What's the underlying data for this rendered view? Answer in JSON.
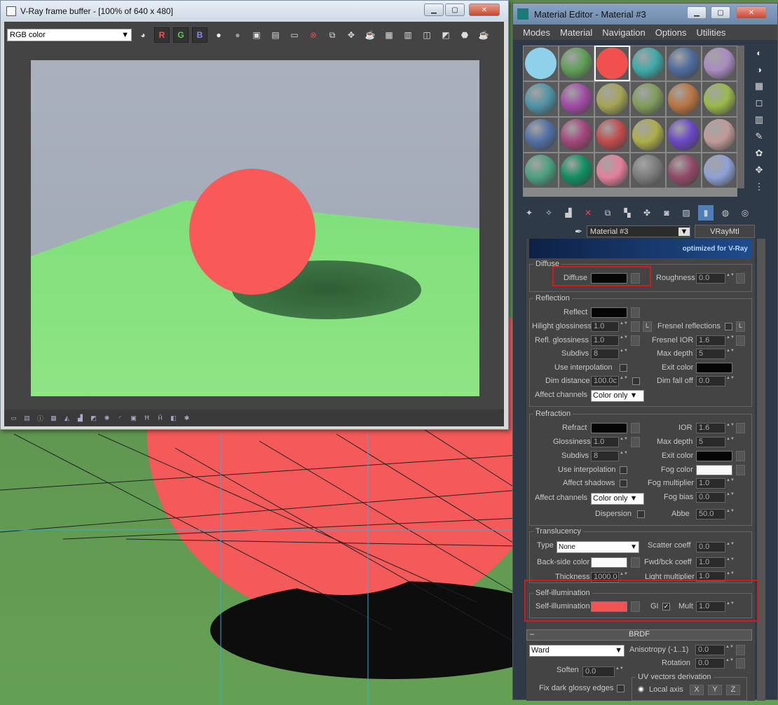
{
  "vfb": {
    "title": "V-Ray frame buffer - [100% of 640 x 480]",
    "channel": "RGB color",
    "ch_r": "R",
    "ch_g": "G",
    "ch_b": "B"
  },
  "me": {
    "title": "Material Editor - Material #3",
    "menus": [
      "Modes",
      "Material",
      "Navigation",
      "Options",
      "Utilities"
    ],
    "material_name": "Material #3",
    "material_type": "VRayMtl",
    "banner": "optimized for V-Ray"
  },
  "slots": [
    "#8fd0ea",
    "#5f9e57",
    "#f24f4f",
    "#3daaa8",
    "#4d6a9c",
    "#a98bc1",
    "#4f93a6",
    "#a04aa5",
    "#a6a454",
    "#7f9c5c",
    "#b9743f",
    "#9ab84a",
    "#4f6ea4",
    "#a3457b",
    "#c04a4a",
    "#adad49",
    "#6a46c5",
    "#c09a97",
    "#4aa07f",
    "#0e8f61",
    "#e47f9a",
    "#7b7b7b",
    "#914a66",
    "#8ea1d6"
  ],
  "diffuse": {
    "title": "Diffuse",
    "diffuse": "Diffuse",
    "roughness": "Roughness",
    "roughness_val": "0.0"
  },
  "reflection": {
    "title": "Reflection",
    "reflect": "Reflect",
    "hilight": "Hilight glossiness",
    "hilight_val": "1.0",
    "refl": "Refl. glossiness",
    "refl_val": "1.0",
    "subdivs": "Subdivs",
    "subdivs_val": "8",
    "interp": "Use interpolation",
    "dim": "Dim distance",
    "dim_val": "100.0c",
    "affect": "Affect channels",
    "affect_val": "Color only",
    "fresnel": "Fresnel reflections",
    "fresnel_ior": "Fresnel IOR",
    "fresnel_ior_val": "1.6",
    "maxd": "Max depth",
    "maxd_val": "5",
    "exit": "Exit color",
    "dimfall": "Dim fall off",
    "dimfall_val": "0.0",
    "L": "L"
  },
  "refraction": {
    "title": "Refraction",
    "refract": "Refract",
    "gloss": "Glossiness",
    "gloss_val": "1.0",
    "subdivs": "Subdivs",
    "subdivs_val": "8",
    "interp": "Use interpolation",
    "shadows": "Affect shadows",
    "affect": "Affect channels",
    "affect_val": "Color only",
    "disp": "Dispersion",
    "ior": "IOR",
    "ior_val": "1.6",
    "maxd": "Max depth",
    "maxd_val": "5",
    "exit": "Exit color",
    "fog": "Fog color",
    "fogmult": "Fog multiplier",
    "fogmult_val": "1.0",
    "fogbias": "Fog bias",
    "fogbias_val": "0.0",
    "abbe": "Abbe",
    "abbe_val": "50.0"
  },
  "transl": {
    "title": "Translucency",
    "type": "Type",
    "type_val": "None",
    "back": "Back-side color",
    "thick": "Thickness",
    "thick_val": "1000.0",
    "scatter": "Scatter coeff",
    "scatter_val": "0.0",
    "fwd": "Fwd/bck coeff",
    "fwd_val": "1.0",
    "light": "Light multiplier",
    "light_val": "1.0"
  },
  "selfillum": {
    "title": "Self-illumination",
    "label": "Self-illumination",
    "gi": "GI",
    "check": "✓",
    "mult": "Mult",
    "mult_val": "1.0",
    "color": "#f45353"
  },
  "brdf": {
    "title": "BRDF",
    "minus": "–",
    "type": "Ward",
    "aniso": "Anisotropy (-1..1)",
    "aniso_val": "0.0",
    "rot": "Rotation",
    "rot_val": "0.0",
    "soften": "Soften",
    "soften_val": "0.0",
    "uv": "UV vectors derivation",
    "local": "Local axis",
    "x": "X",
    "y": "Y",
    "z": "Z",
    "fix": "Fix dark glossy edges"
  }
}
